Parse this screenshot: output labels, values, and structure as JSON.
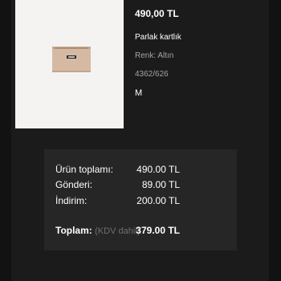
{
  "product": {
    "price": "490,00 TL",
    "name": "Parlak kartlık",
    "color": "Renk: Altın",
    "code": "4362/626",
    "size": "M"
  },
  "summary": {
    "subtotal_label": "Ürün toplamı:",
    "subtotal_value": "490.00 TL",
    "shipping_label": "Gönderi:",
    "shipping_value": "89.00 TL",
    "discount_label": "İndirim:",
    "discount_value": "200.00 TL",
    "total_label": "Toplam:",
    "total_note": "(KDV dahil)",
    "total_value": "379.00 TL"
  },
  "colors": {
    "background": "#121212",
    "panel": "#1b1b1b",
    "summary_box": "#262626",
    "thumbnail_bg": "#f4f3f1",
    "product_color": "#d6b9a3"
  },
  "icons": {
    "product_image": "card-holder-wallet"
  }
}
